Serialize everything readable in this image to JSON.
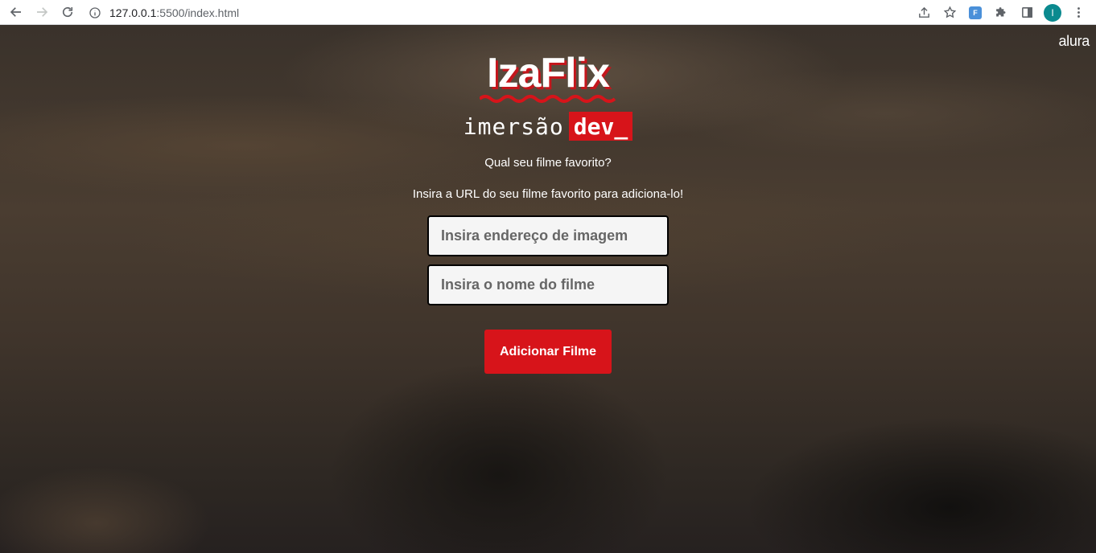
{
  "browser": {
    "url_host": "127.0.0.1",
    "url_path": ":5500/index.html",
    "extension_label": "F",
    "profile_initial": "I"
  },
  "page": {
    "corner_logo": "alura",
    "brand_name": "IzaFlix",
    "imersao_word": "imersão",
    "dev_word": "dev_",
    "question": "Qual seu filme favorito?",
    "instruction": "Insira a URL do seu filme favorito para adiciona-lo!",
    "image_field": {
      "placeholder": "Insira endereço de imagem",
      "value": ""
    },
    "name_field": {
      "placeholder": "Insira o nome do filme",
      "value": ""
    },
    "add_button_label": "Adicionar Filme"
  },
  "colors": {
    "accent_red": "#d7141a",
    "profile_teal": "#0b8a8f"
  }
}
